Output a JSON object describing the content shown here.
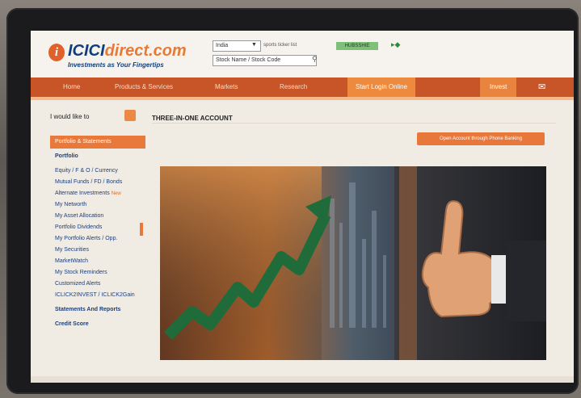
{
  "header": {
    "logo_mark": "i",
    "logo_brand": "ICICI",
    "logo_domain": "direct.com",
    "tagline": "Investments as Your Fingertips",
    "market_select": "India",
    "market_label": "sports ticker list",
    "ticker": "HUBSSHIE",
    "search_placeholder": "Stock Name / Stock Code"
  },
  "nav": {
    "items": [
      {
        "label": "Home"
      },
      {
        "label": "Products & Services"
      },
      {
        "label": "Markets"
      },
      {
        "label": "Research"
      },
      {
        "label": "Start Login Online"
      },
      {
        "label": "Invest"
      }
    ]
  },
  "sidebar": {
    "like_label": "I would like to",
    "portfolio_header": "Portfolio & Statements",
    "items": [
      {
        "label": "Portfolio",
        "top": true
      },
      {
        "label": "Equity / F & O / Currency"
      },
      {
        "label": "Mutual Funds / FD / Bonds"
      },
      {
        "label": "Alternate Investments",
        "badge": "New"
      },
      {
        "label": "My Networth"
      },
      {
        "label": "My Asset Allocation"
      },
      {
        "label": "Portfolio Dividends"
      },
      {
        "label": "My Portfolio Alerts / Opp."
      },
      {
        "label": "My Securities"
      },
      {
        "label": "MarketWatch"
      },
      {
        "label": "My Stock Reminders"
      },
      {
        "label": "Customized Alerts"
      },
      {
        "label": "ICLICK2INVEST / ICLICK2Gain"
      },
      {
        "label": "Statements And Reports",
        "top": true
      },
      {
        "label": "Credit Score",
        "top": true
      }
    ]
  },
  "main": {
    "title": "THREE-IN-ONE ACCOUNT",
    "open_button": "Open Account through Phone Banking"
  },
  "colors": {
    "nav_bg": "#c75528",
    "accent": "#e9793b",
    "brand_blue": "#0d3f7e"
  }
}
